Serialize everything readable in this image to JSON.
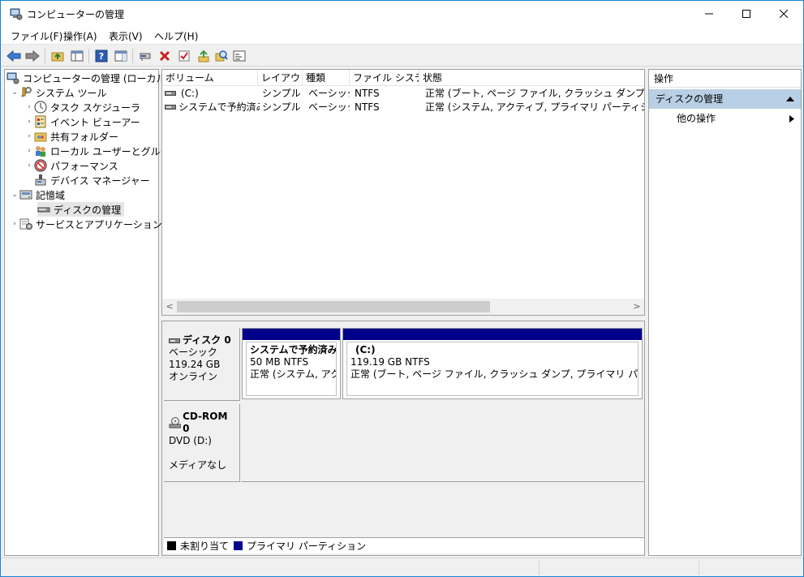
{
  "window": {
    "title": "コンピューターの管理",
    "minimize": "—",
    "maximize": "☐",
    "close": "✕"
  },
  "menu": [
    "ファイル(F)",
    "操作(A)",
    "表示(V)",
    "ヘルプ(H)"
  ],
  "tree": {
    "root": "コンピューターの管理 (ローカル)",
    "system_tools": "システム ツール",
    "task_scheduler": "タスク スケジューラ",
    "event_viewer": "イベント ビューアー",
    "shared_folders": "共有フォルダー",
    "local_users": "ローカル ユーザーとグループ",
    "performance": "パフォーマンス",
    "device_manager": "デバイス マネージャー",
    "storage": "記憶域",
    "disk_management": "ディスクの管理",
    "services": "サービスとアプリケーション"
  },
  "volume_list": {
    "columns": [
      "ボリューム",
      "レイアウト",
      "種類",
      "ファイル システム",
      "状態"
    ],
    "rows": [
      {
        "volume": "(C:)",
        "layout": "シンプル",
        "type": "ベーシック",
        "fs": "NTFS",
        "status": "正常 (ブート, ページ ファイル, クラッシュ ダンプ, プライマリ パーティション)"
      },
      {
        "volume": "システムで予約済み",
        "layout": "シンプル",
        "type": "ベーシック",
        "fs": "NTFS",
        "status": "正常 (システム, アクティブ, プライマリ パーティション)"
      }
    ]
  },
  "disks": {
    "disk0": {
      "name": "ディスク 0",
      "type": "ベーシック",
      "size": "119.24 GB",
      "state": "オンライン",
      "partitions": [
        {
          "name": "システムで予約済み",
          "size": "50 MB NTFS",
          "status": "正常 (システム, アクティブ, プライマリ パーティション)"
        },
        {
          "name": "(C:)",
          "size": "119.19 GB NTFS",
          "status": "正常 (ブート, ページ ファイル, クラッシュ ダンプ, プライマリ パーティション)"
        }
      ]
    },
    "cdrom0": {
      "name": "CD-ROM 0",
      "drive": "DVD (D:)",
      "state": "メディアなし"
    }
  },
  "legend": {
    "unallocated": "未割り当て",
    "primary": "プライマリ パーティション"
  },
  "actions": {
    "header": "操作",
    "section": "ディスクの管理",
    "more": "他の操作"
  },
  "colors": {
    "primary_partition": "#00008b",
    "unallocated": "#000000",
    "selection": "#b8cfe5"
  }
}
